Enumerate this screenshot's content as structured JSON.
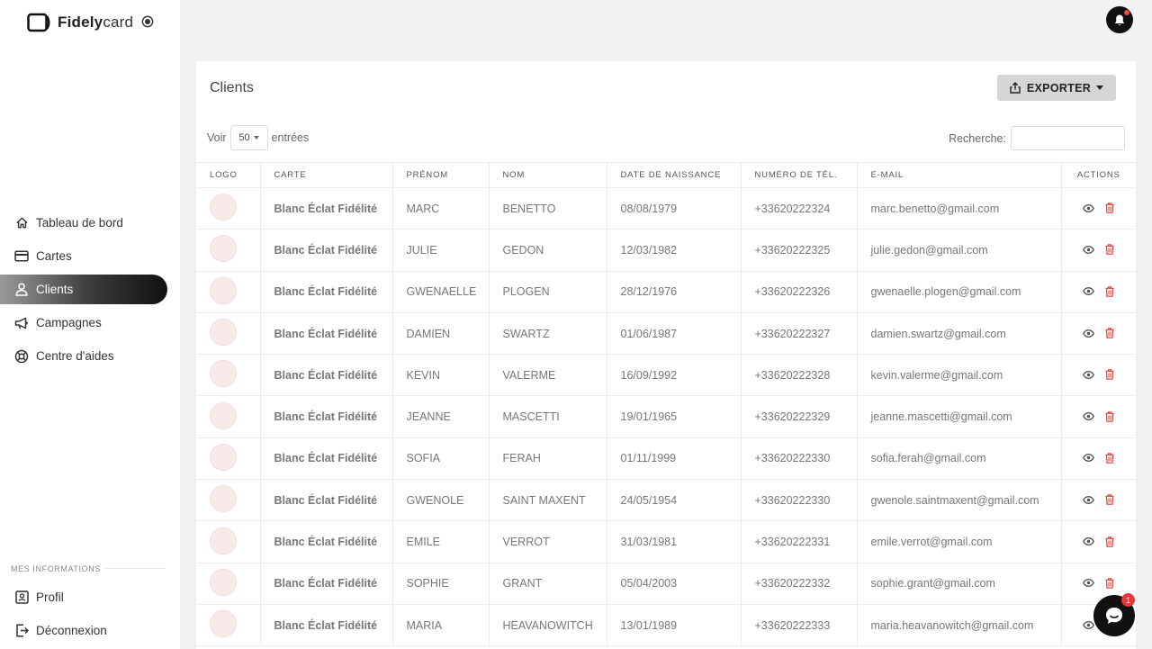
{
  "brand": {
    "name_bold": "Fidely",
    "name_light": "card"
  },
  "nav": {
    "items": [
      {
        "label": "Tableau de bord",
        "icon": "home-icon",
        "active": false
      },
      {
        "label": "Cartes",
        "icon": "card-icon",
        "active": false
      },
      {
        "label": "Clients",
        "icon": "user-icon",
        "active": true
      },
      {
        "label": "Campagnes",
        "icon": "megaphone-icon",
        "active": false
      },
      {
        "label": "Centre d'aides",
        "icon": "help-icon",
        "active": false
      }
    ],
    "section_label": "MES INFORMATIONS",
    "bottom_items": [
      {
        "label": "Profil",
        "icon": "profile-icon"
      },
      {
        "label": "Déconnexion",
        "icon": "logout-icon"
      }
    ]
  },
  "page": {
    "title": "Clients",
    "export_label": "EXPORTER",
    "length_prefix": "Voir",
    "length_value": "50",
    "length_suffix": "entrées",
    "search_label": "Recherche:",
    "search_value": ""
  },
  "table": {
    "columns": [
      "LOGO",
      "CARTE",
      "PRÉNOM",
      "NOM",
      "DATE DE NAISSANCE",
      "NUMÉRO DE TÉL.",
      "E-MAIL",
      "ACTIONS"
    ],
    "rows": [
      {
        "carte": "Blanc Éclat Fidélité",
        "prenom": "MARC",
        "nom": "BENETTO",
        "naissance": "08/08/1979",
        "tel": "+33620222324",
        "email": "marc.benetto@gmail.com"
      },
      {
        "carte": "Blanc Éclat Fidélité",
        "prenom": "JULIE",
        "nom": "GEDON",
        "naissance": "12/03/1982",
        "tel": "+33620222325",
        "email": "julie.gedon@gmail.com"
      },
      {
        "carte": "Blanc Éclat Fidélité",
        "prenom": "GWENAELLE",
        "nom": "PLOGEN",
        "naissance": "28/12/1976",
        "tel": "+33620222326",
        "email": "gwenaelle.plogen@gmail.com"
      },
      {
        "carte": "Blanc Éclat Fidélité",
        "prenom": "DAMIEN",
        "nom": "SWARTZ",
        "naissance": "01/06/1987",
        "tel": "+33620222327",
        "email": "damien.swartz@gmail.com"
      },
      {
        "carte": "Blanc Éclat Fidélité",
        "prenom": "KEVIN",
        "nom": "VALERME",
        "naissance": "16/09/1992",
        "tel": "+33620222328",
        "email": "kevin.valerme@gmail.com"
      },
      {
        "carte": "Blanc Éclat Fidélité",
        "prenom": "JEANNE",
        "nom": "MASCETTI",
        "naissance": "19/01/1965",
        "tel": "+33620222329",
        "email": "jeanne.mascetti@gmail.com"
      },
      {
        "carte": "Blanc Éclat Fidélité",
        "prenom": "SOFIA",
        "nom": "FERAH",
        "naissance": "01/11/1999",
        "tel": "+33620222330",
        "email": "sofia.ferah@gmail.com"
      },
      {
        "carte": "Blanc Éclat Fidélité",
        "prenom": "GWENOLE",
        "nom": "SAINT MAXENT",
        "naissance": "24/05/1954",
        "tel": "+33620222330",
        "email": "gwenole.saintmaxent@gmail.com"
      },
      {
        "carte": "Blanc Éclat Fidélité",
        "prenom": "EMILE",
        "nom": "VERROT",
        "naissance": "31/03/1981",
        "tel": "+33620222331",
        "email": "emile.verrot@gmail.com"
      },
      {
        "carte": "Blanc Éclat Fidélité",
        "prenom": "SOPHIE",
        "nom": "GRANT",
        "naissance": "05/04/2003",
        "tel": "+33620222332",
        "email": "sophie.grant@gmail.com"
      },
      {
        "carte": "Blanc Éclat Fidélité",
        "prenom": "MARIA",
        "nom": "HEAVANOWITCH",
        "naissance": "13/01/1989",
        "tel": "+33620222333",
        "email": "maria.heavanowitch@gmail.com"
      }
    ]
  },
  "chat": {
    "badge_count": "1"
  },
  "colors": {
    "accent": "#111111",
    "danger": "#e53935",
    "eye": "#555555"
  }
}
